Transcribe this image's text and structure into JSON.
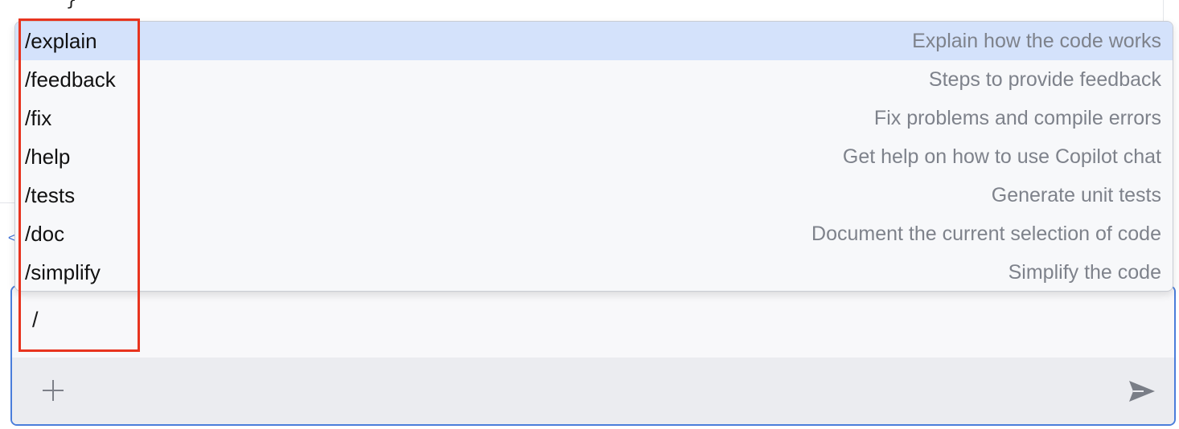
{
  "code": {
    "visible_fragment": "}"
  },
  "side_marker": "<",
  "chat": {
    "input_text": "/",
    "add_icon": "plus-icon",
    "send_icon": "send-icon"
  },
  "commands": [
    {
      "name": "/explain",
      "description": "Explain how the code works"
    },
    {
      "name": "/feedback",
      "description": "Steps to provide feedback"
    },
    {
      "name": "/fix",
      "description": "Fix problems and compile errors"
    },
    {
      "name": "/help",
      "description": "Get help on how to use Copilot chat"
    },
    {
      "name": "/tests",
      "description": "Generate unit tests"
    },
    {
      "name": "/doc",
      "description": "Document the current selection of code"
    },
    {
      "name": "/simplify",
      "description": "Simplify the code"
    }
  ],
  "selected_index": 0,
  "colors": {
    "selection": "#d4e2fb",
    "input_border": "#4a7ddb",
    "annotation_border": "#e8341f",
    "description_text": "#7e828b"
  }
}
